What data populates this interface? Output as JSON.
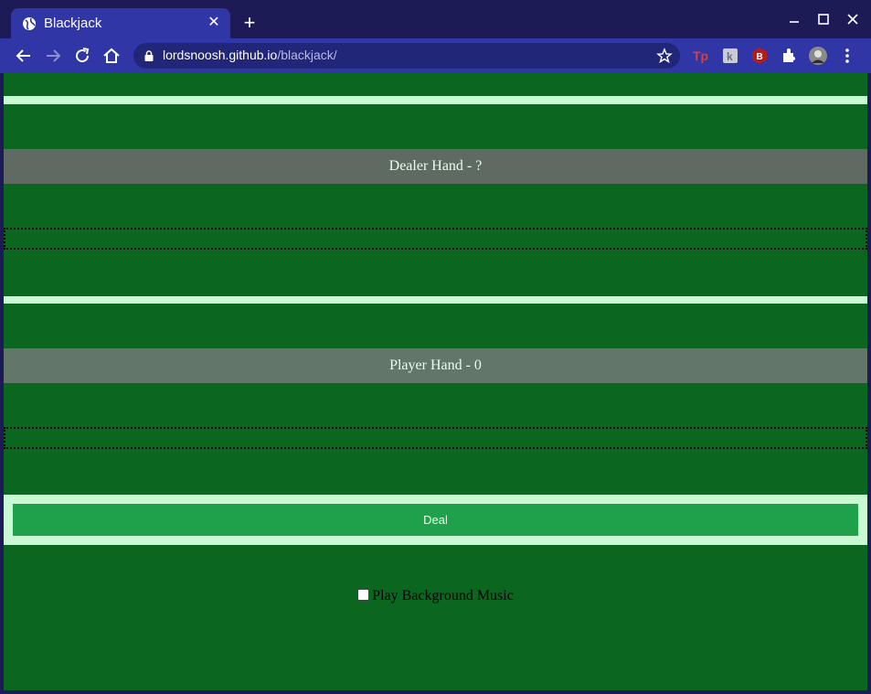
{
  "browser": {
    "tab_title": "Blackjack",
    "url_host": "lordsnoosh.github.io",
    "url_path": "/blackjack/"
  },
  "game": {
    "dealer_label": "Dealer Hand - ?",
    "player_label": "Player Hand - 0",
    "deal_button": "Deal",
    "music_label": "Play Background Music",
    "music_checked": false
  },
  "colors": {
    "table_green": "#0b6620",
    "accent_light_green": "#c8f9d2",
    "deal_button_green": "#1ea14a",
    "hand_label_bg": "#5e6a62",
    "browser_blue": "#3036a6"
  },
  "icons": [
    "globe-icon",
    "close-icon",
    "new-tab-icon",
    "minimize-icon",
    "maximize-icon",
    "window-close-icon",
    "back-icon",
    "forward-icon",
    "reload-icon",
    "home-icon",
    "lock-icon",
    "star-icon",
    "extensions-icon",
    "menu-icon"
  ]
}
